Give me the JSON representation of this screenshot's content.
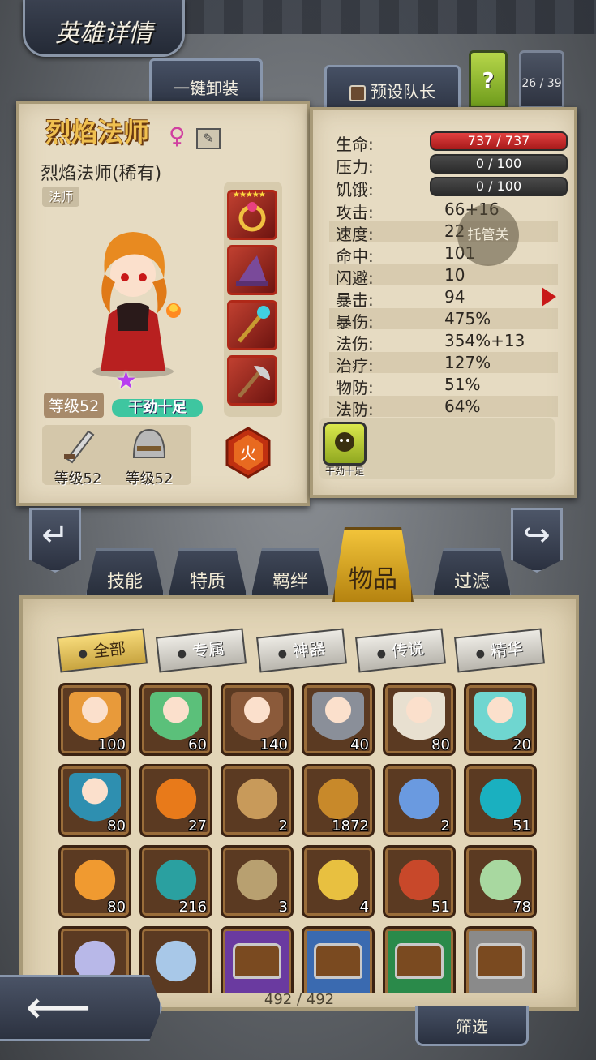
{
  "header": {
    "title": "英雄详情"
  },
  "toolbar": {
    "unload_all": "一键卸装",
    "preset_captain": "预设队长",
    "help": "?",
    "hero_counter": "26 / 39"
  },
  "hero": {
    "name": "烈焰法师",
    "gender_icon": "female-icon",
    "subtitle": "烈焰法师(稀有)",
    "class": "法师",
    "level": "等级52",
    "mood": "干劲十足",
    "element": "火",
    "weapon_level": "等级52",
    "armor_level": "等级52",
    "equipment": [
      {
        "icon": "ring-icon",
        "stars": "★★★★★"
      },
      {
        "icon": "wizard-hat-icon",
        "stars": ""
      },
      {
        "icon": "staff-icon",
        "stars": ""
      },
      {
        "icon": "axe-icon",
        "stars": ""
      }
    ]
  },
  "stats": {
    "hp_label": "生命:",
    "hp_value": "737 / 737",
    "stress_label": "压力:",
    "stress_value": "0 / 100",
    "hunger_label": "饥饿:",
    "hunger_value": "0 / 100",
    "rows": [
      {
        "label": "攻击:",
        "value": "66+16"
      },
      {
        "label": "速度:",
        "value": "22"
      },
      {
        "label": "命中:",
        "value": "101"
      },
      {
        "label": "闪避:",
        "value": "10"
      },
      {
        "label": "暴击:",
        "value": "94"
      },
      {
        "label": "暴伤:",
        "value": "475%"
      },
      {
        "label": "法伤:",
        "value": "354%+13"
      },
      {
        "label": "治疗:",
        "value": "127%"
      },
      {
        "label": "物防:",
        "value": "51%"
      },
      {
        "label": "法防:",
        "value": "64%"
      }
    ],
    "auto_button": "托管关",
    "trait_label": "干劲十足"
  },
  "tabs": [
    {
      "label": "技能"
    },
    {
      "label": "特质"
    },
    {
      "label": "羁绊"
    },
    {
      "label": "物品",
      "active": true
    },
    {
      "label": "过滤"
    }
  ],
  "filters": [
    {
      "label": "全部",
      "active": true
    },
    {
      "label": "专属"
    },
    {
      "label": "神器"
    },
    {
      "label": "传说"
    },
    {
      "label": "精华"
    }
  ],
  "items": [
    {
      "kind": "hero",
      "color": "#e89a3a",
      "count": "100"
    },
    {
      "kind": "hero",
      "color": "#5bc07a",
      "count": "60"
    },
    {
      "kind": "hero",
      "color": "#8b5a3a",
      "count": "140"
    },
    {
      "kind": "hero",
      "color": "#8a8f99",
      "count": "40"
    },
    {
      "kind": "hero",
      "color": "#e8e0d0",
      "count": "80"
    },
    {
      "kind": "hero",
      "color": "#6fd6d0",
      "count": "20"
    },
    {
      "kind": "hero",
      "color": "#2e8fb0",
      "count": "80"
    },
    {
      "kind": "gem",
      "color": "#e87a1a",
      "count": "27"
    },
    {
      "kind": "scroll",
      "color": "#c89a5a",
      "count": "2"
    },
    {
      "kind": "coin",
      "color": "#c8892a",
      "count": "1872"
    },
    {
      "kind": "crystal",
      "color": "#6a9ae0",
      "count": "2"
    },
    {
      "kind": "rune",
      "color": "#1ab0c0",
      "count": "51"
    },
    {
      "kind": "feather",
      "color": "#f09a30",
      "count": "80"
    },
    {
      "kind": "potion",
      "color": "#2aa0a0",
      "count": "216"
    },
    {
      "kind": "orb",
      "color": "#b8a070",
      "count": "3"
    },
    {
      "kind": "card",
      "color": "#e8c040",
      "count": "4"
    },
    {
      "kind": "skull",
      "color": "#c8482a",
      "count": "51"
    },
    {
      "kind": "leaf",
      "color": "#a8d8a0",
      "count": "78"
    },
    {
      "kind": "feather",
      "color": "#b8b8e8",
      "count": ""
    },
    {
      "kind": "feather",
      "color": "#a8c8e8",
      "count": ""
    },
    {
      "kind": "chest",
      "color": "#6a3aa0",
      "count": ""
    },
    {
      "kind": "chest",
      "color": "#3a6ab0",
      "count": ""
    },
    {
      "kind": "chest",
      "color": "#2a8a4a",
      "count": ""
    },
    {
      "kind": "chest",
      "color": "#8a8a8a",
      "count": ""
    }
  ],
  "inventory_count": "492 / 492",
  "bottom": {
    "filter_button": "筛选"
  }
}
